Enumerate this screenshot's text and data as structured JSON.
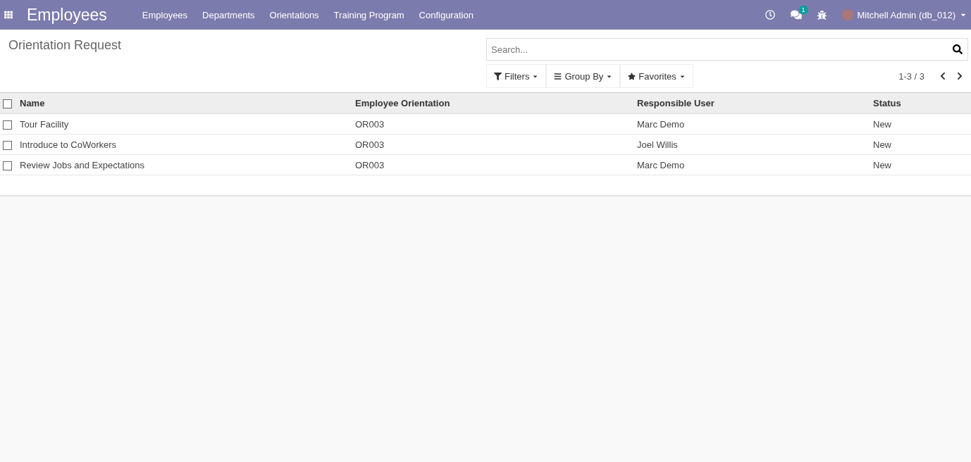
{
  "navbar": {
    "app_title": "Employees",
    "menu": [
      "Employees",
      "Departments",
      "Orientations",
      "Training Program",
      "Configuration"
    ],
    "messages_badge": "1",
    "user": "Mitchell Admin (db_012)"
  },
  "breadcrumb": "Orientation Request",
  "search": {
    "placeholder": "Search..."
  },
  "filters": [
    "Filters",
    "Group By",
    "Favorites"
  ],
  "pager": "1-3 / 3",
  "table": {
    "select_all": {
      "checked": false
    },
    "columns": [
      "Name",
      "Employee Orientation",
      "Responsible User",
      "Status"
    ],
    "rows": [
      {
        "checked": false,
        "cells": [
          "Tour Facility",
          "OR003",
          "Marc Demo",
          "New"
        ]
      },
      {
        "checked": false,
        "cells": [
          "Introduce to CoWorkers",
          "OR003",
          "Joel Willis",
          "New"
        ]
      },
      {
        "checked": false,
        "cells": [
          "Review Jobs and Expectations",
          "OR003",
          "Marc Demo",
          "New"
        ]
      }
    ]
  }
}
